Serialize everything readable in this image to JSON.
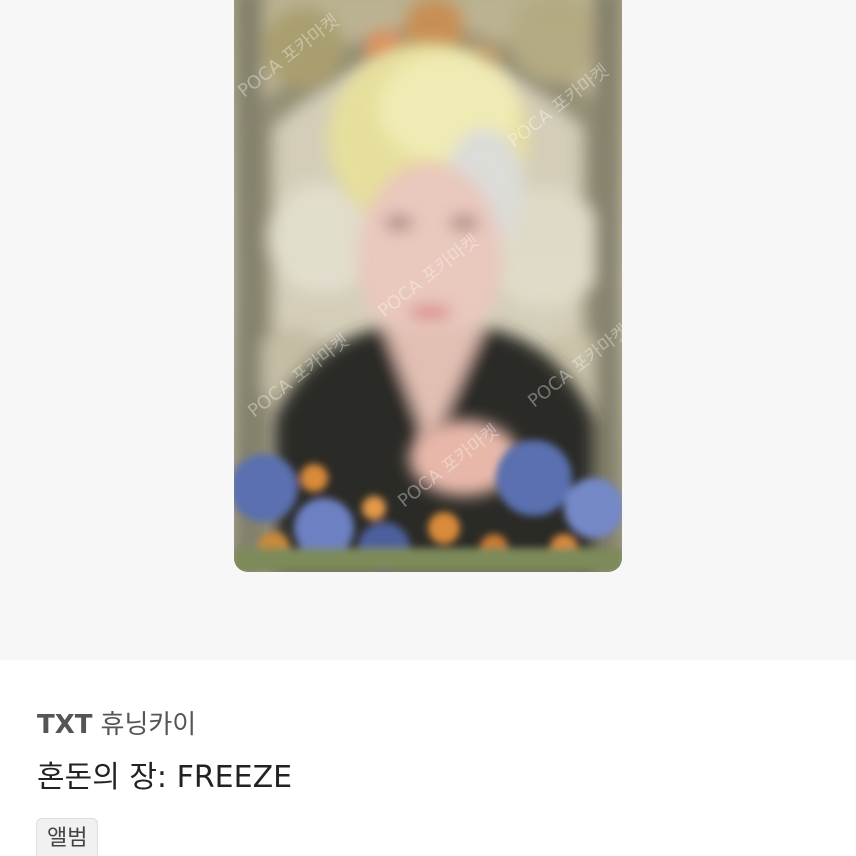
{
  "listing": {
    "photo": {
      "subject": "blurred photocard of a blond-haired member in a dark top, stained-glass background with flowers",
      "watermark_text": "POCA 포카마켓",
      "colors": {
        "stage_bg": "#f7f7f7",
        "card_bg": "#c9c2a8",
        "hair": "#e8de9a",
        "top": "#2b2a28",
        "flowers_blue": "#5a6fb0",
        "flowers_orange": "#d98a3a"
      }
    },
    "artist_group": "TXT",
    "member": "휴닝카이",
    "album_title": "혼돈의 장: FREEZE",
    "category_chip": "앨범"
  }
}
